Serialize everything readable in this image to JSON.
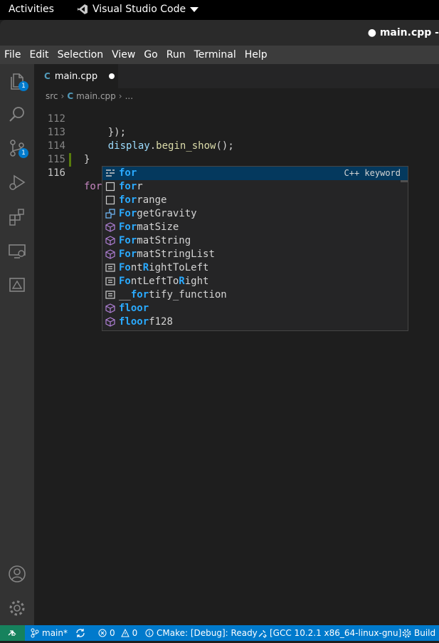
{
  "gnome": {
    "activities": "Activities",
    "app_name": "Visual Studio Code"
  },
  "window": {
    "title": "● main.cpp -"
  },
  "menu": [
    "File",
    "Edit",
    "Selection",
    "View",
    "Go",
    "Run",
    "Terminal",
    "Help"
  ],
  "activity_bar": {
    "explorer_badge": "1",
    "scm_badge": "1",
    "icons": [
      "explorer-icon",
      "search-icon",
      "source-control-icon",
      "run-debug-icon",
      "extensions-icon",
      "remote-explorer-icon",
      "cmake-icon",
      "account-icon",
      "gear-icon"
    ]
  },
  "tab": {
    "label": "main.cpp",
    "icon": "C"
  },
  "breadcrumb": {
    "folder": "src",
    "file": "main.cpp",
    "more": "..."
  },
  "code": {
    "lines": [
      {
        "num": "112",
        "text": "    });"
      },
      {
        "num": "113",
        "pre": "    ",
        "obj": "display",
        "dot": ".",
        "fn": "begin_show",
        "post": "();"
      },
      {
        "num": "114",
        "text": "}"
      },
      {
        "num": "115",
        "text": ""
      },
      {
        "num": "116",
        "typed": "for"
      }
    ]
  },
  "suggest": {
    "items": [
      {
        "icon": "keyword-icon",
        "match": "for",
        "rest": "",
        "pre": "",
        "detail": "C++ keyword"
      },
      {
        "icon": "snippet-icon",
        "match": "for",
        "rest": "r",
        "pre": ""
      },
      {
        "icon": "snippet-icon",
        "match": "for",
        "rest": "range",
        "pre": ""
      },
      {
        "icon": "method-icon",
        "match": "For",
        "rest": "getGravity",
        "pre": ""
      },
      {
        "icon": "class-icon",
        "match": "For",
        "rest": "matSize",
        "pre": ""
      },
      {
        "icon": "class-icon",
        "match": "For",
        "rest": "matString",
        "pre": ""
      },
      {
        "icon": "class-icon",
        "match": "For",
        "rest": "matStringList",
        "pre": ""
      },
      {
        "icon": "constant-icon",
        "segments": [
          "Fo",
          "nt",
          "R",
          "ightToLeft"
        ]
      },
      {
        "icon": "constant-icon",
        "segments": [
          "Fo",
          "ntLeftTo",
          "R",
          "ight"
        ]
      },
      {
        "icon": "constant-icon",
        "segments": [
          "",
          "__",
          "for",
          "tify_function"
        ]
      },
      {
        "icon": "class-icon",
        "segments": [
          "flo",
          "",
          "or",
          ""
        ]
      },
      {
        "icon": "class-icon",
        "segments": [
          "flo",
          "",
          "or",
          "f128"
        ]
      }
    ]
  },
  "status": {
    "branch": "main*",
    "errors": "0",
    "warnings": "0",
    "cmake": "CMake: [Debug]: Ready",
    "kit": "[GCC 10.2.1 x86_64-linux-gnu]",
    "build": "Build"
  },
  "colors": {
    "status_bar": "#007acc",
    "remote": "#16825d",
    "highlight": "#2aaaff",
    "selected_row": "#04395e"
  }
}
